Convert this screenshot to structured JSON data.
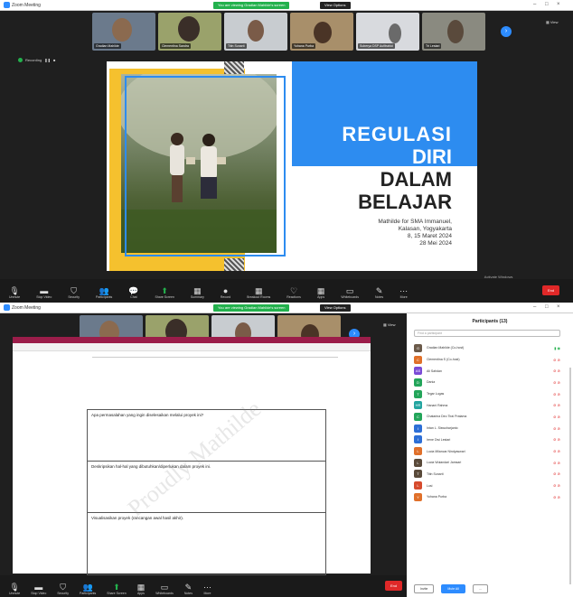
{
  "window1": {
    "title": "Zoom Meeting",
    "share_banner": "You are viewing Gradian Mahilde's screen",
    "share_stop": "View Options",
    "participants": [
      {
        "name": "Gradian Mahilde"
      },
      {
        "name": "Clementina Sandra"
      },
      {
        "name": "Titin Sunarti"
      },
      {
        "name": "Yohana Purba"
      },
      {
        "name": "Suberya DSP Aufitrahid"
      },
      {
        "name": "Tri Lestari"
      }
    ],
    "view": "View",
    "recording": "Recording",
    "slide": {
      "line1": "REGULASI",
      "line2": "DIRI",
      "line3": "DALAM",
      "line4": "BELAJAR",
      "sub1": "Mathilde for SMA Immanuel,",
      "sub2": "Kalasan, Yogyakarta",
      "sub3": "8, 15 Maret 2024",
      "sub4": "28 Mei 2024"
    },
    "watermark1": "Activate Windows",
    "watermark2": "Go to Settings to activate Windows."
  },
  "toolbar": {
    "items": [
      {
        "label": "Unmute",
        "icon": "🎙"
      },
      {
        "label": "Stop Video",
        "icon": "▬"
      },
      {
        "label": "Security",
        "icon": "⛉"
      },
      {
        "label": "Participants",
        "icon": "👥"
      },
      {
        "label": "Chat",
        "icon": "💬"
      },
      {
        "label": "Share Screen",
        "icon": "⬆"
      },
      {
        "label": "Summary",
        "icon": "▦"
      },
      {
        "label": "Record",
        "icon": "●"
      },
      {
        "label": "Breakout Rooms",
        "icon": "▦"
      },
      {
        "label": "Reactions",
        "icon": "♡"
      },
      {
        "label": "Apps",
        "icon": "▦"
      },
      {
        "label": "Whiteboards",
        "icon": "▭"
      },
      {
        "label": "Notes",
        "icon": "✎"
      },
      {
        "label": "More",
        "icon": "⋯"
      }
    ],
    "end": "End"
  },
  "window2": {
    "title": "Zoom Meeting",
    "share_banner": "You are viewing Gradian Mahilde's screen",
    "share_stop": "View Options",
    "participants": [
      {
        "name": "Gradian Mahilde"
      },
      {
        "name": "Clementina Sandra"
      },
      {
        "name": "Titin Sunarti"
      },
      {
        "name": "Yohana Purba"
      }
    ],
    "view": "View",
    "recording": "Recording",
    "questions": [
      "Apa permasalahan yang ingin diselesaikan melalui proyek ini?",
      "Deskripsikan hal-hal yang dibutuhkan/diperlukan dalam proyek ini.",
      "Visualisasikan proyek (rancangan awal hasil akhir)."
    ],
    "doc_watermark": "Proudly Mathilde",
    "panel": {
      "title": "Participants (13)",
      "search": "Find a participant",
      "people": [
        {
          "name": "Gradian Mahilde (Co-host)",
          "initial": "G",
          "color": "#6b5a4a"
        },
        {
          "name": "Clementina S (Co-host)",
          "initial": "C",
          "color": "#e0702a"
        },
        {
          "name": "Ali Sahdan",
          "initial": "AS",
          "color": "#7a4bd6"
        },
        {
          "name": "Dania",
          "initial": "D",
          "color": "#23a55a"
        },
        {
          "name": "Tegar Lugas",
          "initial": "T",
          "color": "#23a55a"
        },
        {
          "name": "Hanani Rahma",
          "initial": "HR",
          "color": "#23a5a0"
        },
        {
          "name": "Chatarina Deo Tirai Pratama",
          "initial": "C",
          "color": "#23a55a"
        },
        {
          "name": "Intan L. Siswoharjanto",
          "initial": "I",
          "color": "#2d6fd6"
        },
        {
          "name": "Irene Dwi Lestari",
          "initial": "I",
          "color": "#2d6fd6"
        },
        {
          "name": "Lucia Milancar Nindyaswari",
          "initial": "L",
          "color": "#e0702a"
        },
        {
          "name": "Lucia Wulandari Jamsari",
          "initial": "L",
          "color": "#5a4a3a"
        },
        {
          "name": "Titin Sunarti",
          "initial": "T",
          "color": "#5a4a3a"
        },
        {
          "name": "Lusi",
          "initial": "L",
          "color": "#d64b2d"
        },
        {
          "name": "Yohana Purba",
          "initial": "Y",
          "color": "#e0702a"
        }
      ],
      "invite": "Invite",
      "mute_all": "Mute All",
      "more": "..."
    }
  }
}
